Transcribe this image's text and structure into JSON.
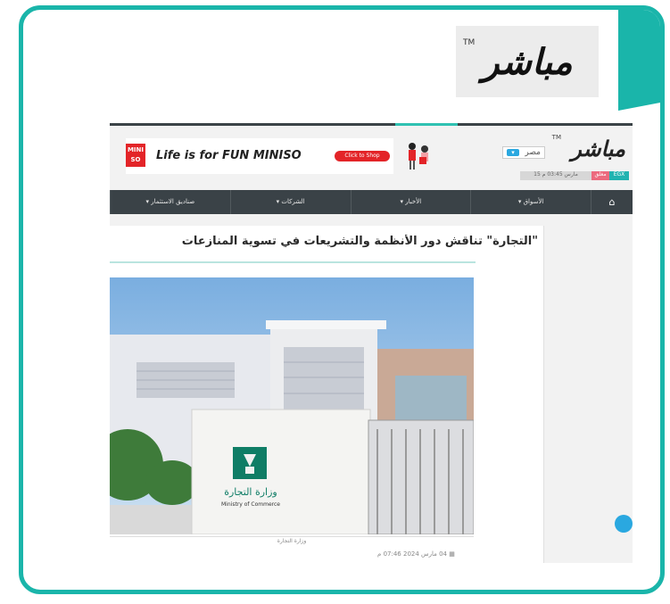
{
  "brand": {
    "logo_text": "مباشر",
    "tm": "TM"
  },
  "site": {
    "logo_text": "مباشر",
    "tm": "TM",
    "country_label": "مصر",
    "ticker": {
      "egx": "EGX",
      "status": "مغلق",
      "date": "15 مارس 03:45 م"
    }
  },
  "ad": {
    "brand": "MINI SO",
    "tagline": "Life is for FUN MINISO",
    "button": "Click to Shop"
  },
  "nav": {
    "home_icon": "home-icon",
    "items": [
      "الأسواق ▾",
      "الأخبار ▾",
      "الشركات ▾",
      "صناديق الاستثمار ▾"
    ]
  },
  "article": {
    "headline": "\"التجارة\" تناقش دور الأنظمة والتشريعات في تسوية المنازعات",
    "photo_sign_ar": "وزارة التجارة",
    "photo_sign_en": "Ministry of Commerce",
    "caption": "وزارة التجارة",
    "date": "04 مارس 2024 07:46 م"
  },
  "colors": {
    "accent": "#1ab5aa",
    "nav_bg": "#3a4247",
    "ad_red": "#e32428"
  }
}
